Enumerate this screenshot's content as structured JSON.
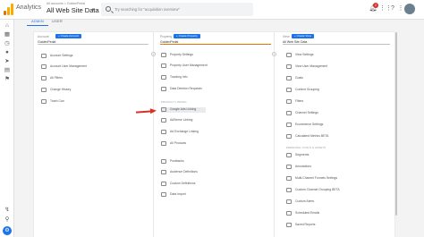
{
  "topbar": {
    "app_title": "Analytics",
    "breadcrumb": "All accounts > GoldenPedal",
    "view_name": "All Web Site Data",
    "search_placeholder": "Try searching for \"acquisition overview\"",
    "notification_count": "2"
  },
  "tabs": [
    {
      "label": "ADMIN",
      "active": true
    },
    {
      "label": "USER",
      "active": false
    }
  ],
  "columns": {
    "account": {
      "header": "Account",
      "create_label": "+ Create Account",
      "selected": "GoldenPedal",
      "items": [
        {
          "label": "Account Settings",
          "icon": "building-icon"
        },
        {
          "label": "Account User Management",
          "icon": "users-icon"
        },
        {
          "label": "All Filters",
          "icon": "filter-icon"
        },
        {
          "label": "Change History",
          "icon": "history-icon"
        },
        {
          "label": "Trash Can",
          "icon": "trash-icon"
        }
      ]
    },
    "property": {
      "header": "Property",
      "create_label": "+ Create Property",
      "selected": "GoldenPedal",
      "items_top": [
        {
          "label": "Property Settings",
          "icon": "document-icon"
        },
        {
          "label": "Property User Management",
          "icon": "users-icon"
        },
        {
          "label": "Tracking Info",
          "icon": "code-icon"
        },
        {
          "label": "Data Deletion Requests",
          "icon": "database-icon"
        }
      ],
      "section_linking": "PRODUCT LINKING",
      "items_linking": [
        {
          "label": "Google Ads Linking",
          "icon": "ads-icon",
          "highlighted": true
        },
        {
          "label": "AdSense Linking",
          "icon": "adsense-icon"
        },
        {
          "label": "Ad Exchange Linking",
          "icon": "exchange-icon"
        },
        {
          "label": "All Products",
          "icon": "grid-icon"
        }
      ],
      "items_bottom": [
        {
          "label": "Postbacks",
          "icon": "postback-icon"
        },
        {
          "label": "Audience Definitions",
          "icon": "audience-icon"
        },
        {
          "label": "Custom Definitions",
          "icon": "dd-icon"
        },
        {
          "label": "Data Import",
          "icon": "import-icon"
        }
      ]
    },
    "view": {
      "header": "View",
      "create_label": "+ Create View",
      "selected": "All Web Site Data",
      "items_top": [
        {
          "label": "View Settings",
          "icon": "document-icon"
        },
        {
          "label": "View User Management",
          "icon": "users-icon"
        },
        {
          "label": "Goals",
          "icon": "flag-icon"
        },
        {
          "label": "Content Grouping",
          "icon": "grouping-icon"
        },
        {
          "label": "Filters",
          "icon": "filter-icon"
        },
        {
          "label": "Channel Settings",
          "icon": "channel-icon"
        },
        {
          "label": "Ecommerce Settings",
          "icon": "cart-icon"
        },
        {
          "label": "Calculated Metrics BETA",
          "icon": "calc-icon"
        }
      ],
      "section_personal": "PERSONAL TOOLS & ASSETS",
      "items_personal": [
        {
          "label": "Segments",
          "icon": "segments-icon"
        },
        {
          "label": "Annotations",
          "icon": "annotation-icon"
        },
        {
          "label": "Multi-Channel Funnels Settings",
          "icon": "funnel-icon"
        },
        {
          "label": "Custom Channel Grouping BETA",
          "icon": "channel-icon"
        },
        {
          "label": "Custom Alerts",
          "icon": "alert-icon"
        },
        {
          "label": "Scheduled Emails",
          "icon": "email-icon"
        },
        {
          "label": "Saved Reports",
          "icon": "report-icon"
        }
      ]
    }
  },
  "colors": {
    "accent": "#1a73e8",
    "highlight_arrow": "#d93025",
    "active_underline": "#e37400"
  }
}
